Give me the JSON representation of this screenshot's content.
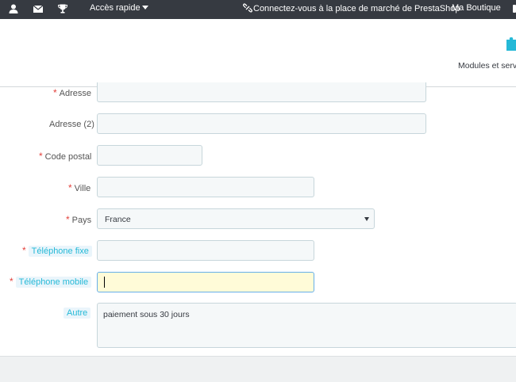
{
  "topbar": {
    "quick_access": "Accès rapide",
    "marketplace": "Connectez-vous à la place de marché de PrestaShop",
    "shop": "Ma Boutique",
    "icons": [
      "user-icon",
      "envelope-icon",
      "trophy-icon",
      "caret-down-icon",
      "link-icon"
    ]
  },
  "header": {
    "modules_label": "Modules et servic",
    "icon": "puzzle-icon"
  },
  "form": {
    "address": {
      "label": "Adresse",
      "value": ""
    },
    "address2": {
      "label": "Adresse (2)",
      "value": ""
    },
    "postcode": {
      "label": "Code postal",
      "value": ""
    },
    "city": {
      "label": "Ville",
      "value": ""
    },
    "country": {
      "label": "Pays",
      "value": "France"
    },
    "phone": {
      "label": "Téléphone fixe",
      "value": ""
    },
    "mobile": {
      "label": "Téléphone mobile",
      "value": ""
    },
    "other": {
      "label": "Autre",
      "value": "paiement sous 30 jours"
    },
    "required_mark": "*"
  },
  "colors": {
    "topbar": "#363a41",
    "required": "#e3413c",
    "hint": "#25b9d7",
    "focus_bg": "#fffbd8"
  }
}
